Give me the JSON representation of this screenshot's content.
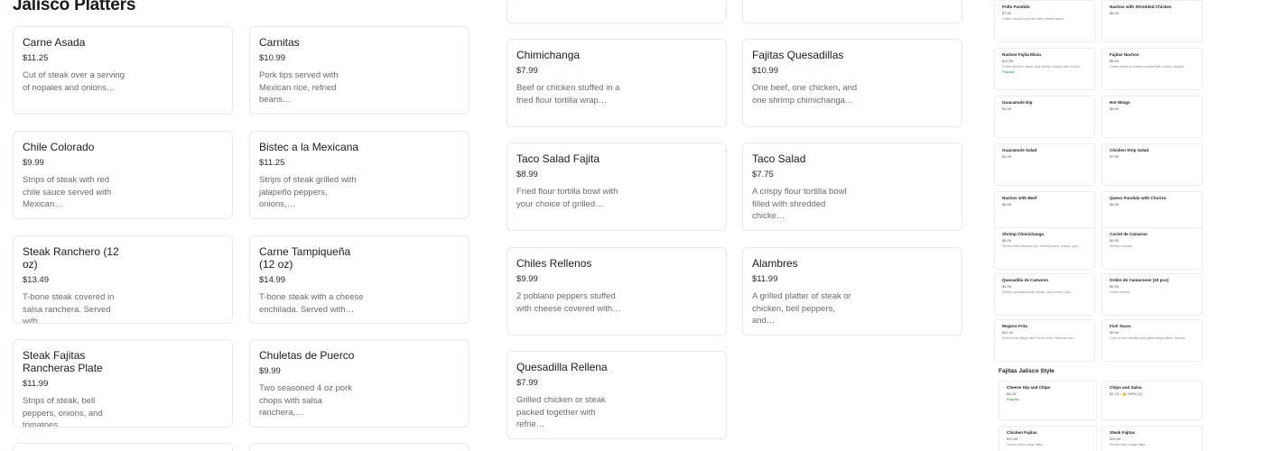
{
  "section": {
    "title": "Jalisco Platters"
  },
  "col1": [
    {
      "name": "Carne Asada",
      "price": "$11.25",
      "desc": "Cut of steak over a serving of nopales and onions…"
    },
    {
      "name": "Chile Colorado",
      "price": "$9.99",
      "desc": "Strips of steak with red chile sauce served with Mexican…"
    },
    {
      "name": "Steak Ranchero (12 oz)",
      "price": "$13.49",
      "desc": "T-bone steak covered in salsa ranchera. Served with…"
    },
    {
      "name": "Steak Fajitas Rancheras Plate",
      "price": "$11.99",
      "desc": "Strips of steak, bell peppers, onions, and tomatoes…"
    }
  ],
  "col2": [
    {
      "name": "Carnitas",
      "price": "$10.99",
      "desc": "Pork tips served with Mexican rice, refried beans…"
    },
    {
      "name": "Bistec a la Mexicana",
      "price": "$11.25",
      "desc": "Strips of steak grilled with jalapeño peppers, onions,…"
    },
    {
      "name": "Carne Tampiqueña (12 oz)",
      "price": "$14.99",
      "desc": "T-bone steak with a cheese enchilada. Served with…"
    },
    {
      "name": "Chuletas de Puerco",
      "price": "$9.99",
      "desc": "Two seasoned 4 oz pork chops with salsa ranchera,…"
    }
  ],
  "col3": [
    {
      "name": "Chimichanga",
      "price": "$7.99",
      "desc": "Beef or chicken stuffed in a fried flour tortilla wrap…"
    },
    {
      "name": "Taco Salad Fajita",
      "price": "$8.99",
      "desc": "Fried flour tortilla bowl with your choice of grilled…"
    },
    {
      "name": "Chiles Rellenos",
      "price": "$9.99",
      "desc": "2 poblano peppers stuffed with cheese covered with…"
    },
    {
      "name": "Quesadilla Rellena",
      "price": "$7.99",
      "desc": "Grilled chicken or steak packed together with refrie…"
    }
  ],
  "col4": [
    {
      "name": "Fajitas Quesadillas",
      "price": "$10.99",
      "desc": "One beef, one chicken, and one shrimp chimichanga…"
    },
    {
      "name": "Taco Salad",
      "price": "$7.75",
      "desc": "A crispy flour tortilla bowl filled with shredded chicke…"
    },
    {
      "name": "Alambres",
      "price": "$11.99",
      "desc": "A grilled platter of steak or chicken, bell peppers, and…"
    }
  ],
  "mini_left": [
    {
      "name": "Pollo Fundido",
      "price": "$7.99",
      "desc": "Grilled chicken and rice with cheese sauce"
    },
    {
      "name": "Nachos Fajita Mixta",
      "price": "$10.99",
      "desc": "Grilled chicken, steak, and shrimp cooked with onions…",
      "tag": "Popular"
    },
    {
      "name": "Guacamole Dip",
      "price": "$3.49",
      "desc": ""
    },
    {
      "name": "Guacamole Salad",
      "price": "$2.99",
      "desc": ""
    },
    {
      "name": "Nachos with Beef",
      "price": "$6.99",
      "desc": ""
    },
    {
      "name": "Shrimp Chimichanga",
      "price": "$9.25",
      "desc": "Served with Mexican rice, refried beans, lettuce, pico…"
    },
    {
      "name": "Quesadilla de Camaron",
      "price": "$9.99",
      "desc": "Shrimp quesadilla with lettuce, sour cream, and…"
    },
    {
      "name": "Mojarra Frita",
      "price": "$11.49",
      "desc": "Fried whole tilapia with French fries, Mexican rice…"
    }
  ],
  "mini_right": [
    {
      "name": "Nachos with Shredded Chicken",
      "price": "$6.99",
      "desc": ""
    },
    {
      "name": "Fajitas Nachos",
      "price": "$8.99",
      "desc": "Grilled steak or chicken cooked with onions, pepper…"
    },
    {
      "name": "Hot Wings",
      "price": "$8.99",
      "desc": ""
    },
    {
      "name": "Chicken Strip Salad",
      "price": "$7.99",
      "desc": ""
    },
    {
      "name": "Queso Fundido with Chorizo",
      "price": "$5.99",
      "desc": ""
    },
    {
      "name": "Coctel de Camaron",
      "price": "$9.99",
      "desc": "Shrimp cocktail."
    },
    {
      "name": "Orden de Camarones (20 pcs)",
      "price": "$9.99",
      "desc": "Grilled shrimp."
    },
    {
      "name": "Fish Tacos",
      "price": "$9.99",
      "desc": "Corn or flour tortillas with grilled tilapia fillets. Served…"
    }
  ],
  "mini_section": {
    "title": "Fajitas Jalisco Style"
  },
  "mini_bottom": [
    {
      "name": "Cheese Dip and Chips",
      "price": "$3.25",
      "desc": "",
      "tag": "Popular"
    },
    {
      "name": "Chips and Salsa",
      "price": "$1.75 • 👍 100% (3)",
      "desc": ""
    },
    {
      "name": "Chicken Fajitas",
      "price": "$10.99",
      "desc": "Served with a large fajita"
    },
    {
      "name": "Steak Fajitas",
      "price": "$10.99",
      "desc": "Served with a large fajita"
    }
  ]
}
